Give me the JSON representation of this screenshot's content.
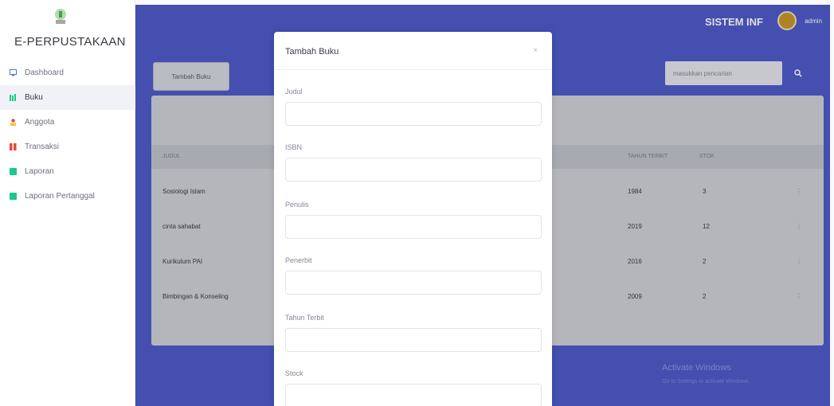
{
  "sidebar": {
    "brand": "E-PERPUSTAKAAN",
    "items": [
      {
        "label": "Dashboard",
        "icon": "monitor-icon",
        "color": "#4e73df",
        "active": false
      },
      {
        "label": "Buku",
        "icon": "books-icon",
        "color": "#1cc88a",
        "active": true
      },
      {
        "label": "Anggota",
        "icon": "user-icon",
        "color": "#e74a3b",
        "active": false
      },
      {
        "label": "Transaksi",
        "icon": "transaction-icon",
        "color": "#e74a3b",
        "active": false
      },
      {
        "label": "Laporan",
        "icon": "report-icon",
        "color": "#1cc88a",
        "active": false
      },
      {
        "label": "Laporan Pertanggal",
        "icon": "report-date-icon",
        "color": "#1cc88a",
        "active": false
      }
    ]
  },
  "topbar": {
    "title": "SISTEM INF",
    "user": "admin"
  },
  "toolbar": {
    "add_label": "Tambah Buku",
    "search_placeholder": "masukkan pencarian"
  },
  "table": {
    "headers": [
      "JUDUL",
      "TAHUN TERBIT",
      "STOK"
    ],
    "rows": [
      {
        "judul": "Sosiologi Islam",
        "tahun": "1984",
        "stok": "3"
      },
      {
        "judul": "cinta sahabat",
        "tahun": "2019",
        "stok": "12"
      },
      {
        "judul": "Kurikulum PAI",
        "tahun": "2016",
        "stok": "2"
      },
      {
        "judul": "Bimbingan & Konseling",
        "tahun": "2009",
        "stok": "2"
      }
    ]
  },
  "modal": {
    "title": "Tambah Buku",
    "close": "×",
    "fields": [
      {
        "label": "Judul"
      },
      {
        "label": "ISBN"
      },
      {
        "label": "Penulis"
      },
      {
        "label": "Penerbit"
      },
      {
        "label": "Tahun Terbit"
      },
      {
        "label": "Stock"
      }
    ]
  },
  "watermark": {
    "line1": "Activate Windows",
    "line2": "Go to Settings to activate Windows."
  },
  "colors": {
    "primary": "#4e5ac9",
    "backdrop": "#cfd0d7"
  }
}
